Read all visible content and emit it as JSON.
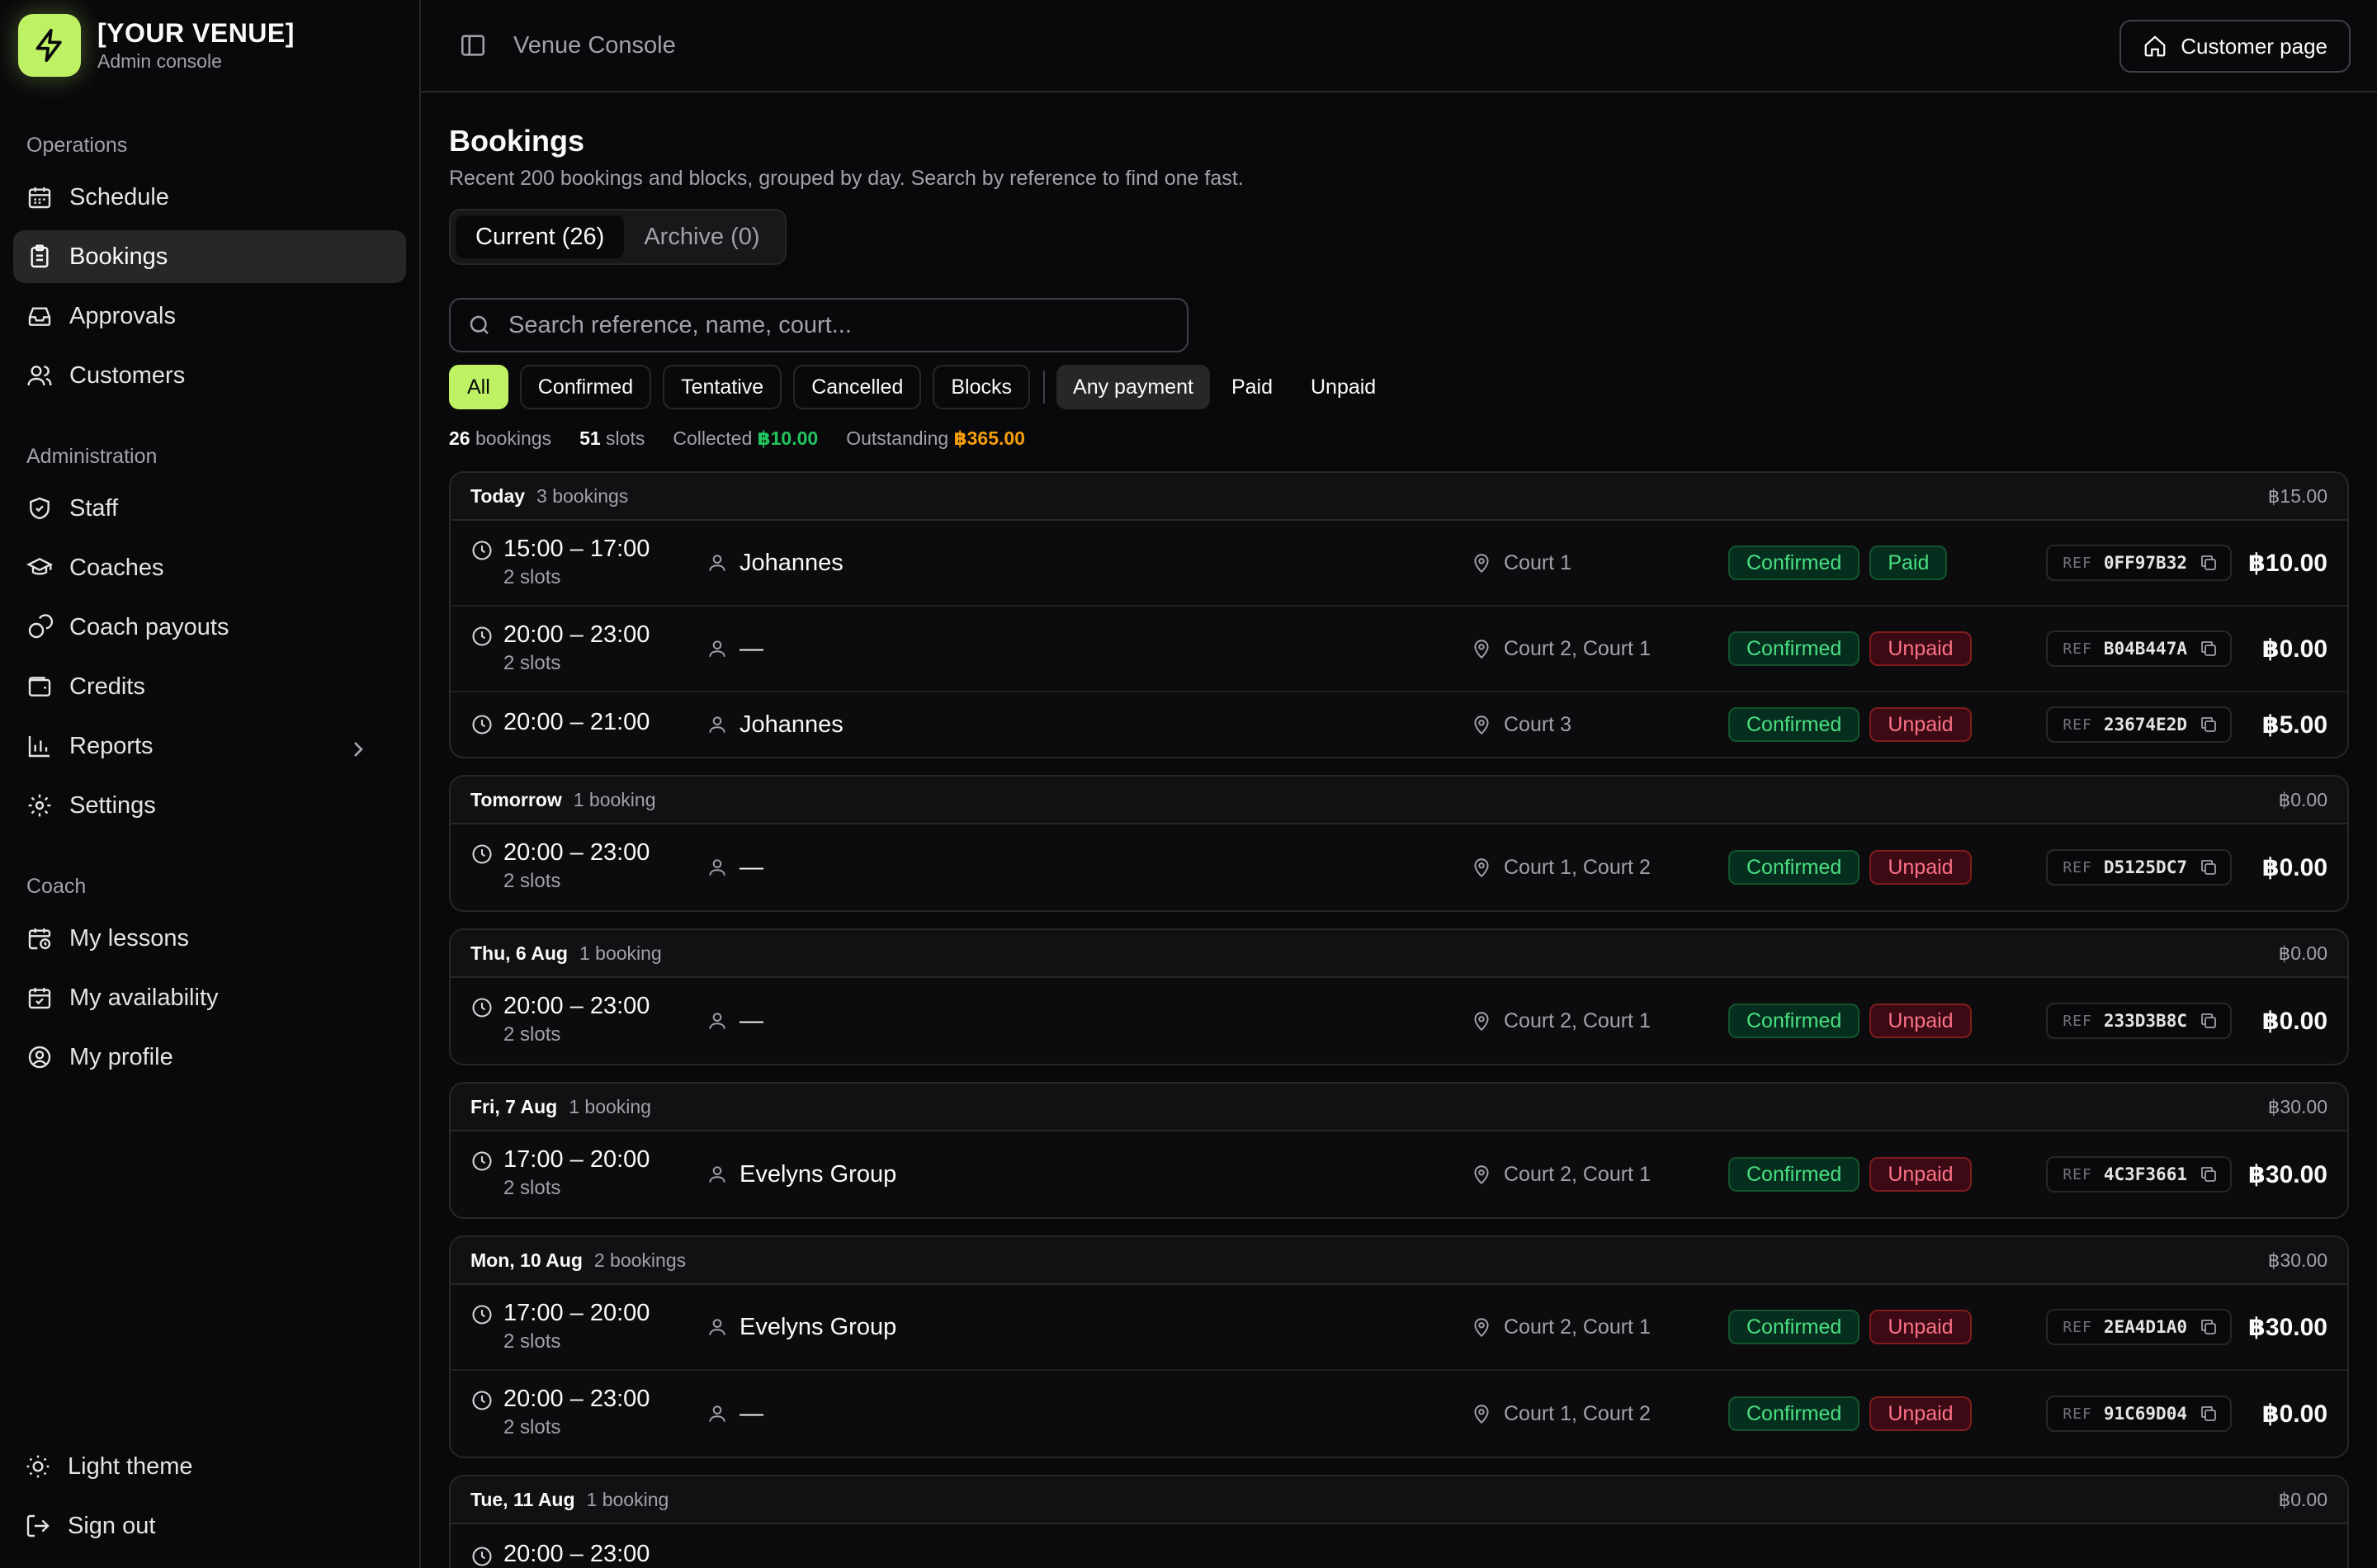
{
  "brand": {
    "name": "[YOUR VENUE]",
    "subtitle": "Admin console"
  },
  "sidebar": {
    "sections": [
      {
        "label": "Operations",
        "items": [
          {
            "label": "Schedule",
            "icon": "calendar-icon"
          },
          {
            "label": "Bookings",
            "icon": "clipboard-icon",
            "active": true
          },
          {
            "label": "Approvals",
            "icon": "inbox-icon"
          },
          {
            "label": "Customers",
            "icon": "users-icon"
          }
        ]
      },
      {
        "label": "Administration",
        "items": [
          {
            "label": "Staff",
            "icon": "shield-icon"
          },
          {
            "label": "Coaches",
            "icon": "graduation-cap-icon"
          },
          {
            "label": "Coach payouts",
            "icon": "coins-icon"
          },
          {
            "label": "Credits",
            "icon": "wallet-icon"
          },
          {
            "label": "Reports",
            "icon": "bar-chart-icon"
          },
          {
            "label": "Settings",
            "icon": "gear-icon"
          }
        ]
      },
      {
        "label": "Coach",
        "items": [
          {
            "label": "My lessons",
            "icon": "calendar-clock-icon"
          },
          {
            "label": "My availability",
            "icon": "calendar-check-icon"
          },
          {
            "label": "My profile",
            "icon": "user-circle-icon"
          }
        ]
      }
    ],
    "bottom": {
      "theme_label": "Light theme",
      "signout_label": "Sign out"
    }
  },
  "topbar": {
    "title": "Venue Console",
    "customer_page_label": "Customer page"
  },
  "page": {
    "title": "Bookings",
    "subtitle": "Recent 200 bookings and blocks, grouped by day. Search by reference to find one fast.",
    "tabs": {
      "current": "Current (26)",
      "archive": "Archive (0)"
    },
    "search_placeholder": "Search reference, name, court...",
    "filters": {
      "all": "All",
      "confirmed": "Confirmed",
      "tentative": "Tentative",
      "cancelled": "Cancelled",
      "blocks": "Blocks",
      "any_payment": "Any payment",
      "paid": "Paid",
      "unpaid": "Unpaid"
    },
    "stats": {
      "bookings_num": "26",
      "bookings_label": "bookings",
      "slots_num": "51",
      "slots_label": "slots",
      "collected_label": "Collected",
      "collected_value": "฿10.00",
      "outstanding_label": "Outstanding",
      "outstanding_value": "฿365.00"
    },
    "ref_label": "REF"
  },
  "colors": {
    "accent": "#bef264",
    "positive": "#22c55e",
    "warning": "#f59e0b",
    "danger": "#fb7185"
  },
  "groups": [
    {
      "day": "Today",
      "count": "3 bookings",
      "total": "฿15.00",
      "rows": [
        {
          "time": "15:00 – 17:00",
          "slots": "2 slots",
          "name": "Johannes",
          "court": "Court 1",
          "status": "Confirmed",
          "payment": "Paid",
          "ref": "0FF97B32",
          "amount": "฿10.00"
        },
        {
          "time": "20:00 – 23:00",
          "slots": "2 slots",
          "name": "—",
          "court": "Court 2, Court 1",
          "status": "Confirmed",
          "payment": "Unpaid",
          "ref": "B04B447A",
          "amount": "฿0.00"
        },
        {
          "time": "20:00 – 21:00",
          "slots": "",
          "name": "Johannes",
          "court": "Court 3",
          "status": "Confirmed",
          "payment": "Unpaid",
          "ref": "23674E2D",
          "amount": "฿5.00"
        }
      ]
    },
    {
      "day": "Tomorrow",
      "count": "1 booking",
      "total": "฿0.00",
      "rows": [
        {
          "time": "20:00 – 23:00",
          "slots": "2 slots",
          "name": "—",
          "court": "Court 1, Court 2",
          "status": "Confirmed",
          "payment": "Unpaid",
          "ref": "D5125DC7",
          "amount": "฿0.00"
        }
      ]
    },
    {
      "day": "Thu, 6 Aug",
      "count": "1 booking",
      "total": "฿0.00",
      "rows": [
        {
          "time": "20:00 – 23:00",
          "slots": "2 slots",
          "name": "—",
          "court": "Court 2, Court 1",
          "status": "Confirmed",
          "payment": "Unpaid",
          "ref": "233D3B8C",
          "amount": "฿0.00"
        }
      ]
    },
    {
      "day": "Fri, 7 Aug",
      "count": "1 booking",
      "total": "฿30.00",
      "rows": [
        {
          "time": "17:00 – 20:00",
          "slots": "2 slots",
          "name": "Evelyns Group",
          "court": "Court 2, Court 1",
          "status": "Confirmed",
          "payment": "Unpaid",
          "ref": "4C3F3661",
          "amount": "฿30.00"
        }
      ]
    },
    {
      "day": "Mon, 10 Aug",
      "count": "2 bookings",
      "total": "฿30.00",
      "rows": [
        {
          "time": "17:00 – 20:00",
          "slots": "2 slots",
          "name": "Evelyns Group",
          "court": "Court 2, Court 1",
          "status": "Confirmed",
          "payment": "Unpaid",
          "ref": "2EA4D1A0",
          "amount": "฿30.00"
        },
        {
          "time": "20:00 – 23:00",
          "slots": "2 slots",
          "name": "—",
          "court": "Court 1, Court 2",
          "status": "Confirmed",
          "payment": "Unpaid",
          "ref": "91C69D04",
          "amount": "฿0.00"
        }
      ]
    },
    {
      "day": "Tue, 11 Aug",
      "count": "1 booking",
      "total": "฿0.00",
      "rows": [
        {
          "time": "20:00 – 23:00",
          "slots": "",
          "name": "",
          "court": "",
          "status": "",
          "payment": "",
          "ref": "",
          "amount": ""
        }
      ]
    }
  ]
}
